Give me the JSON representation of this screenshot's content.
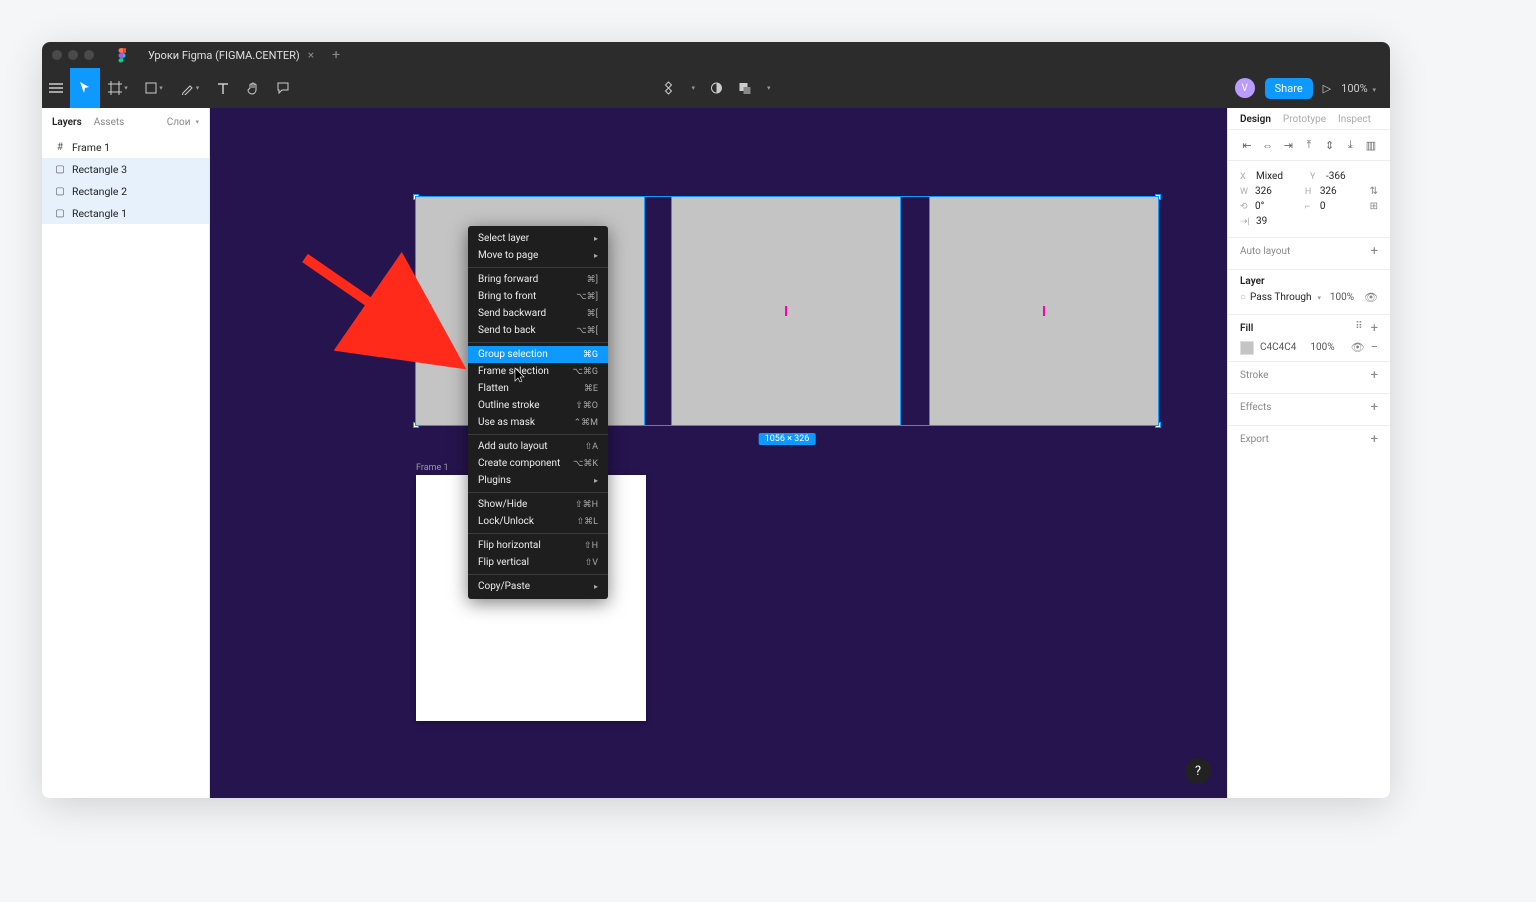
{
  "window": {
    "tab_title": "Уроки Figma (FIGMA.CENTER)"
  },
  "toolbar": {
    "share_label": "Share",
    "zoom_label": "100%",
    "avatar_initial": "V"
  },
  "left_panel": {
    "tabs": {
      "layers": "Layers",
      "assets": "Assets"
    },
    "pages_label": "Слои",
    "layers": [
      {
        "name": "Frame 1",
        "icon": "frame",
        "selected": false
      },
      {
        "name": "Rectangle 3",
        "icon": "rect",
        "selected": true
      },
      {
        "name": "Rectangle 2",
        "icon": "rect",
        "selected": true
      },
      {
        "name": "Rectangle 1",
        "icon": "rect",
        "selected": true
      }
    ]
  },
  "canvas": {
    "selection_dims": "1056 × 326",
    "frame_label": "Frame 1"
  },
  "context_menu": {
    "groups": [
      [
        {
          "label": "Select layer",
          "shortcut": "",
          "submenu": true
        },
        {
          "label": "Move to page",
          "shortcut": "",
          "submenu": true
        }
      ],
      [
        {
          "label": "Bring forward",
          "shortcut": "⌘]"
        },
        {
          "label": "Bring to front",
          "shortcut": "⌥⌘]"
        },
        {
          "label": "Send backward",
          "shortcut": "⌘["
        },
        {
          "label": "Send to back",
          "shortcut": "⌥⌘["
        }
      ],
      [
        {
          "label": "Group selection",
          "shortcut": "⌘G",
          "highlight": true
        },
        {
          "label": "Frame selection",
          "shortcut": "⌥⌘G"
        },
        {
          "label": "Flatten",
          "shortcut": "⌘E"
        },
        {
          "label": "Outline stroke",
          "shortcut": "⇧⌘O"
        },
        {
          "label": "Use as mask",
          "shortcut": "⌃⌘M"
        }
      ],
      [
        {
          "label": "Add auto layout",
          "shortcut": "⇧A"
        },
        {
          "label": "Create component",
          "shortcut": "⌥⌘K"
        },
        {
          "label": "Plugins",
          "shortcut": "",
          "submenu": true
        }
      ],
      [
        {
          "label": "Show/Hide",
          "shortcut": "⇧⌘H"
        },
        {
          "label": "Lock/Unlock",
          "shortcut": "⇧⌘L"
        }
      ],
      [
        {
          "label": "Flip horizontal",
          "shortcut": "⇧H"
        },
        {
          "label": "Flip vertical",
          "shortcut": "⇧V"
        }
      ],
      [
        {
          "label": "Copy/Paste",
          "shortcut": "",
          "submenu": true
        }
      ]
    ]
  },
  "design_panel": {
    "tabs": {
      "design": "Design",
      "prototype": "Prototype",
      "inspect": "Inspect"
    },
    "position": {
      "x": "Mixed",
      "y": "-366",
      "w": "326",
      "h": "326",
      "rotation": "0°",
      "radius": "0",
      "gap": "39"
    },
    "auto_layout_label": "Auto layout",
    "layer_label": "Layer",
    "layer_blend": "Pass Through",
    "layer_opacity": "100%",
    "fill_label": "Fill",
    "fill_hex": "C4C4C4",
    "fill_opacity": "100%",
    "stroke_label": "Stroke",
    "effects_label": "Effects",
    "export_label": "Export"
  }
}
